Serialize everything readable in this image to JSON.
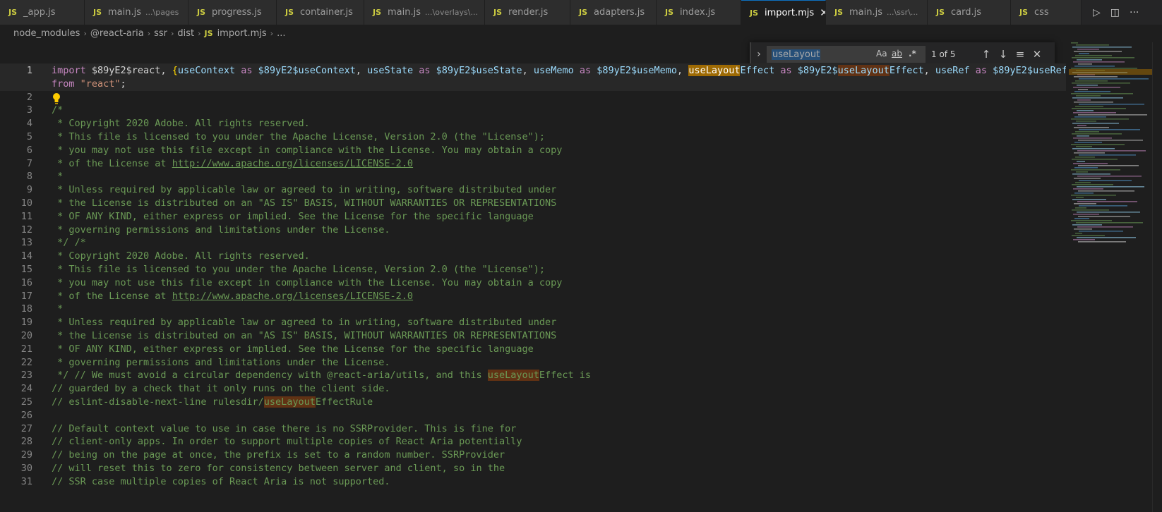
{
  "tabs": [
    {
      "label": "_app.js",
      "hint": "",
      "active": false
    },
    {
      "label": "main.js",
      "hint": "...\\pages",
      "active": false
    },
    {
      "label": "progress.js",
      "hint": "",
      "active": false
    },
    {
      "label": "container.js",
      "hint": "",
      "active": false
    },
    {
      "label": "main.js",
      "hint": "...\\overlays\\...",
      "active": false
    },
    {
      "label": "render.js",
      "hint": "",
      "active": false
    },
    {
      "label": "adapters.js",
      "hint": "",
      "active": false
    },
    {
      "label": "index.js",
      "hint": "",
      "active": false
    },
    {
      "label": "import.mjs",
      "hint": "",
      "active": true
    },
    {
      "label": "main.js",
      "hint": "...\\ssr\\...",
      "active": false
    },
    {
      "label": "card.js",
      "hint": "",
      "active": false
    },
    {
      "label": "css",
      "hint": "",
      "active": false
    }
  ],
  "tab_icon_text": "JS",
  "close_glyph": "✕",
  "breadcrumb": [
    "node_modules",
    "@react-aria",
    "ssr",
    "dist",
    "import.mjs",
    "..."
  ],
  "find": {
    "query": "useLayout",
    "match_case": "Aa",
    "whole_word": "ab",
    "regex": ".*",
    "result": "1 of 5"
  },
  "editor": {
    "lines": [
      {
        "n": "1",
        "tokens": [
          [
            "kw",
            "import "
          ],
          [
            "plain",
            "$89yE2$react"
          ],
          [
            "pn",
            ", "
          ],
          [
            "brk",
            "{"
          ],
          [
            "id",
            "useContext"
          ],
          [
            "kw",
            " as "
          ],
          [
            "id",
            "$89yE2$useContext"
          ],
          [
            "pn",
            ", "
          ],
          [
            "id",
            "useState"
          ],
          [
            "kw",
            " as "
          ],
          [
            "id",
            "$89yE2$useState"
          ],
          [
            "pn",
            ", "
          ],
          [
            "id",
            "useMemo"
          ],
          [
            "kw",
            " as "
          ],
          [
            "id",
            "$89yE2$useMemo"
          ],
          [
            "pn",
            ", "
          ],
          [
            "hlc",
            "useLayout"
          ],
          [
            "id",
            "Effect"
          ],
          [
            "kw",
            " as "
          ],
          [
            "id",
            "$89yE2$"
          ],
          [
            "hl",
            "useLayout"
          ],
          [
            "id",
            "Effect"
          ],
          [
            "pn",
            ", "
          ],
          [
            "id",
            "useRef"
          ],
          [
            "kw",
            " as "
          ],
          [
            "id",
            "$89yE2$useRef"
          ],
          [
            "brk",
            "}"
          ]
        ]
      },
      {
        "n": "",
        "tokens": [
          [
            "kw",
            "from "
          ],
          [
            "str",
            "\"react\""
          ],
          [
            "pn",
            ";"
          ]
        ]
      },
      {
        "n": "2",
        "tokens": []
      },
      {
        "n": "3",
        "tokens": [
          [
            "cm",
            "/*"
          ]
        ]
      },
      {
        "n": "4",
        "tokens": [
          [
            "cm",
            " * Copyright 2020 Adobe. All rights reserved."
          ]
        ]
      },
      {
        "n": "5",
        "tokens": [
          [
            "cm",
            " * This file is licensed to you under the Apache License, Version 2.0 (the \"License\");"
          ]
        ]
      },
      {
        "n": "6",
        "tokens": [
          [
            "cm",
            " * you may not use this file except in compliance with the License. You may obtain a copy"
          ]
        ]
      },
      {
        "n": "7",
        "tokens": [
          [
            "cm",
            " * of the License at "
          ],
          [
            "link",
            "http://www.apache.org/licenses/LICENSE-2.0"
          ]
        ]
      },
      {
        "n": "8",
        "tokens": [
          [
            "cm",
            " *"
          ]
        ]
      },
      {
        "n": "9",
        "tokens": [
          [
            "cm",
            " * Unless required by applicable law or agreed to in writing, software distributed under"
          ]
        ]
      },
      {
        "n": "10",
        "tokens": [
          [
            "cm",
            " * the License is distributed on an \"AS IS\" BASIS, WITHOUT WARRANTIES OR REPRESENTATIONS"
          ]
        ]
      },
      {
        "n": "11",
        "tokens": [
          [
            "cm",
            " * OF ANY KIND, either express or implied. See the License for the specific language"
          ]
        ]
      },
      {
        "n": "12",
        "tokens": [
          [
            "cm",
            " * governing permissions and limitations under the License."
          ]
        ]
      },
      {
        "n": "13",
        "tokens": [
          [
            "cm",
            " */ /*"
          ]
        ]
      },
      {
        "n": "14",
        "tokens": [
          [
            "cm",
            " * Copyright 2020 Adobe. All rights reserved."
          ]
        ]
      },
      {
        "n": "15",
        "tokens": [
          [
            "cm",
            " * This file is licensed to you under the Apache License, Version 2.0 (the \"License\");"
          ]
        ]
      },
      {
        "n": "16",
        "tokens": [
          [
            "cm",
            " * you may not use this file except in compliance with the License. You may obtain a copy"
          ]
        ]
      },
      {
        "n": "17",
        "tokens": [
          [
            "cm",
            " * of the License at "
          ],
          [
            "link",
            "http://www.apache.org/licenses/LICENSE-2.0"
          ]
        ]
      },
      {
        "n": "18",
        "tokens": [
          [
            "cm",
            " *"
          ]
        ]
      },
      {
        "n": "19",
        "tokens": [
          [
            "cm",
            " * Unless required by applicable law or agreed to in writing, software distributed under"
          ]
        ]
      },
      {
        "n": "20",
        "tokens": [
          [
            "cm",
            " * the License is distributed on an \"AS IS\" BASIS, WITHOUT WARRANTIES OR REPRESENTATIONS"
          ]
        ]
      },
      {
        "n": "21",
        "tokens": [
          [
            "cm",
            " * OF ANY KIND, either express or implied. See the License for the specific language"
          ]
        ]
      },
      {
        "n": "22",
        "tokens": [
          [
            "cm",
            " * governing permissions and limitations under the License."
          ]
        ]
      },
      {
        "n": "23",
        "tokens": [
          [
            "cm",
            " */ // We must avoid a circular dependency with @react-aria/utils, and this "
          ],
          [
            "hlcm",
            "useLayout"
          ],
          [
            "cm",
            "Effect is"
          ]
        ]
      },
      {
        "n": "24",
        "tokens": [
          [
            "cm",
            "// guarded by a check that it only runs on the client side."
          ]
        ]
      },
      {
        "n": "25",
        "tokens": [
          [
            "cm",
            "// eslint-disable-next-line rulesdir/"
          ],
          [
            "hlcm",
            "useLayout"
          ],
          [
            "cm",
            "EffectRule"
          ]
        ]
      },
      {
        "n": "26",
        "tokens": []
      },
      {
        "n": "27",
        "tokens": [
          [
            "cm",
            "// Default context value to use in case there is no SSRProvider. This is fine for"
          ]
        ]
      },
      {
        "n": "28",
        "tokens": [
          [
            "cm",
            "// client-only apps. In order to support multiple copies of React Aria potentially"
          ]
        ]
      },
      {
        "n": "29",
        "tokens": [
          [
            "cm",
            "// being on the page at once, the prefix is set to a random number. SSRProvider"
          ]
        ]
      },
      {
        "n": "30",
        "tokens": [
          [
            "cm",
            "// will reset this to zero for consistency between server and client, so in the"
          ]
        ]
      },
      {
        "n": "31",
        "tokens": [
          [
            "cm",
            "// SSR case multiple copies of React Aria is not supported."
          ]
        ]
      }
    ]
  },
  "colors": {
    "accent": "#0e70c0",
    "match_current": "#9e6a03",
    "match_other": "#613214",
    "comment": "#6a9955",
    "keyword": "#c586c0",
    "variable": "#9cdcfe",
    "string": "#ce9178"
  }
}
